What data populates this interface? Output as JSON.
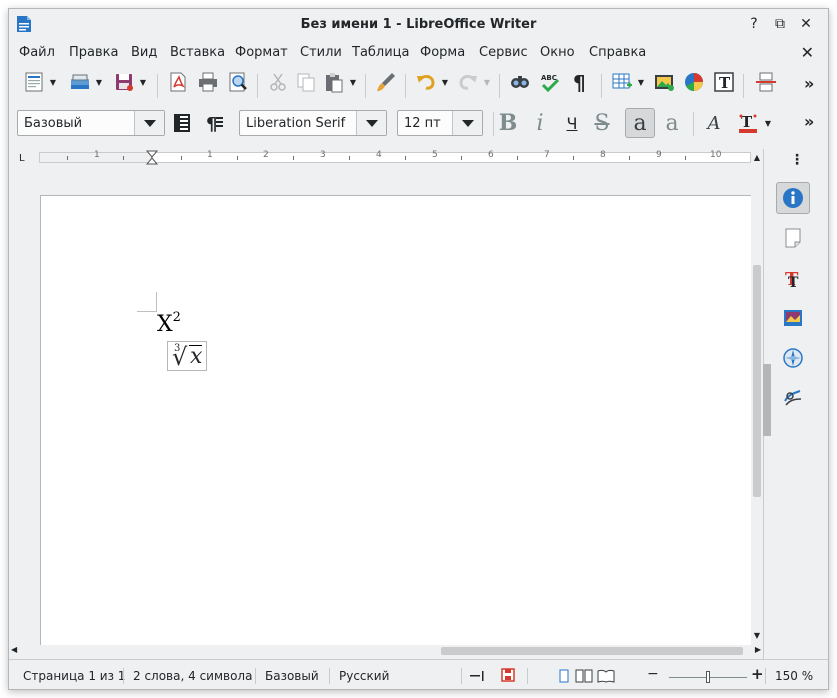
{
  "window": {
    "title": "Без имени 1 - LibreOffice Writer",
    "controls": {
      "minimize": "?",
      "restore": "⧉",
      "close": "✕"
    }
  },
  "menu": {
    "items": [
      "Файл",
      "Правка",
      "Вид",
      "Вставка",
      "Формат",
      "Стили",
      "Таблица",
      "Форма",
      "Сервис",
      "Окно",
      "Справка"
    ],
    "close_doc": "✕"
  },
  "toolbar_standard": {
    "icons": [
      "new-document",
      "open",
      "save",
      "export-pdf",
      "print",
      "print-preview",
      "cut",
      "copy",
      "paste",
      "clone-formatting",
      "undo",
      "redo",
      "find-replace",
      "spelling",
      "formatting-marks",
      "insert-table",
      "insert-image",
      "insert-chart",
      "insert-text-box",
      "insert-page-break"
    ],
    "overflow": "»"
  },
  "toolbar_formatting": {
    "paragraph_style": "Базовый",
    "font_name": "Liberation Serif",
    "font_size": "12 пт",
    "bold": "B",
    "italic": "i",
    "underline": "Ч",
    "strikethrough": "S",
    "superscript": "a",
    "subscript": "a",
    "clear_format": "A",
    "overflow": "»"
  },
  "ruler": {
    "marks": [
      "1",
      "1",
      "2",
      "3",
      "4",
      "5",
      "6",
      "7",
      "8",
      "9",
      "10"
    ],
    "corner": "L"
  },
  "document": {
    "formula1_base": "X",
    "formula1_sup": "2",
    "formula2_index": "3",
    "formula2_radical": "√",
    "formula2_var": "x"
  },
  "sidebar": {
    "menu": "⋮",
    "buttons": [
      "properties",
      "page",
      "styles",
      "gallery",
      "navigator",
      "manage-changes"
    ],
    "active": "properties"
  },
  "statusbar": {
    "page": "Страница 1 из 1",
    "words": "2 слова, 4 символа",
    "style": "Базовый",
    "language": "Русский",
    "zoom_minus": "−",
    "zoom_plus": "+",
    "zoom": "150 %",
    "zoom_level": 0.5
  },
  "colors": {
    "window_bg": "#eff0f1",
    "accent_blue": "#2a76c6",
    "pdf_red": "#d63a2e",
    "page_bg": "#ffffff"
  }
}
